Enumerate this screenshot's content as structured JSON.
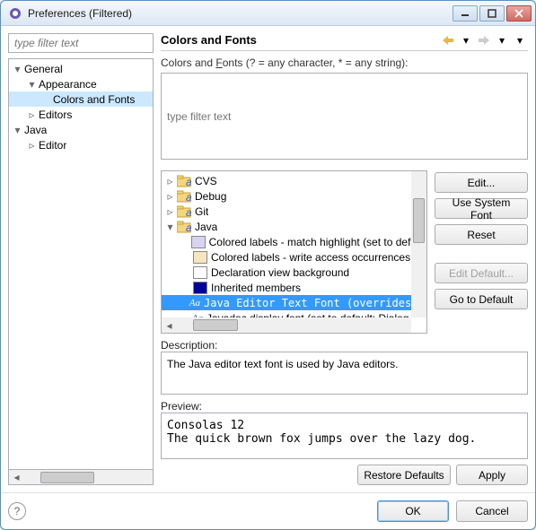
{
  "window": {
    "title": "Preferences (Filtered)"
  },
  "sidebar": {
    "filter_placeholder": "type filter text",
    "items": [
      {
        "label": "General",
        "depth": 0,
        "twisty": "▾"
      },
      {
        "label": "Appearance",
        "depth": 1,
        "twisty": "▾"
      },
      {
        "label": "Colors and Fonts",
        "depth": 2,
        "twisty": "",
        "selected": true
      },
      {
        "label": "Editors",
        "depth": 1,
        "twisty": "▹"
      },
      {
        "label": "Java",
        "depth": 0,
        "twisty": "▾"
      },
      {
        "label": "Editor",
        "depth": 1,
        "twisty": "▹"
      }
    ]
  },
  "main": {
    "title": "Colors and Fonts",
    "hint": "Colors and Fonts (? = any character, * = any string):",
    "filter_placeholder": "type filter text",
    "tree": [
      {
        "label": "CVS",
        "type": "folder",
        "twisty": "▹",
        "depth": 0
      },
      {
        "label": "Debug",
        "type": "folder",
        "twisty": "▹",
        "depth": 0
      },
      {
        "label": "Git",
        "type": "folder",
        "twisty": "▹",
        "depth": 0
      },
      {
        "label": "Java",
        "type": "folder",
        "twisty": "▾",
        "depth": 0
      },
      {
        "label": "Colored labels - match highlight (set to default: RGB...",
        "type": "swatch",
        "color": "#d9d3f2",
        "depth": 1
      },
      {
        "label": "Colored labels - write access occurrences",
        "type": "swatch",
        "color": "#f5e6c0",
        "depth": 1
      },
      {
        "label": "Declaration view background",
        "type": "swatch",
        "color": "#ffffff",
        "depth": 1
      },
      {
        "label": "Inherited members",
        "type": "swatch",
        "color": "#000099",
        "depth": 1
      },
      {
        "label": "Java Editor Text Font (overrides default: Text Font)",
        "type": "font",
        "depth": 1,
        "selected": true,
        "mono": true
      },
      {
        "label": "Javadoc display font (set to default: Dialog Font)",
        "type": "font",
        "depth": 1
      }
    ],
    "buttons": {
      "edit": "Edit...",
      "use_system_font": "Use System Font",
      "reset": "Reset",
      "edit_default": "Edit Default...",
      "go_to_default": "Go to Default"
    },
    "description_label": "Description:",
    "description_text": "The Java editor text font is used by Java editors.",
    "preview_label": "Preview:",
    "preview_text": "Consolas 12\nThe quick brown fox jumps over the lazy dog.",
    "restore_defaults": "Restore Defaults",
    "apply": "Apply"
  },
  "bottom": {
    "ok": "OK",
    "cancel": "Cancel"
  }
}
